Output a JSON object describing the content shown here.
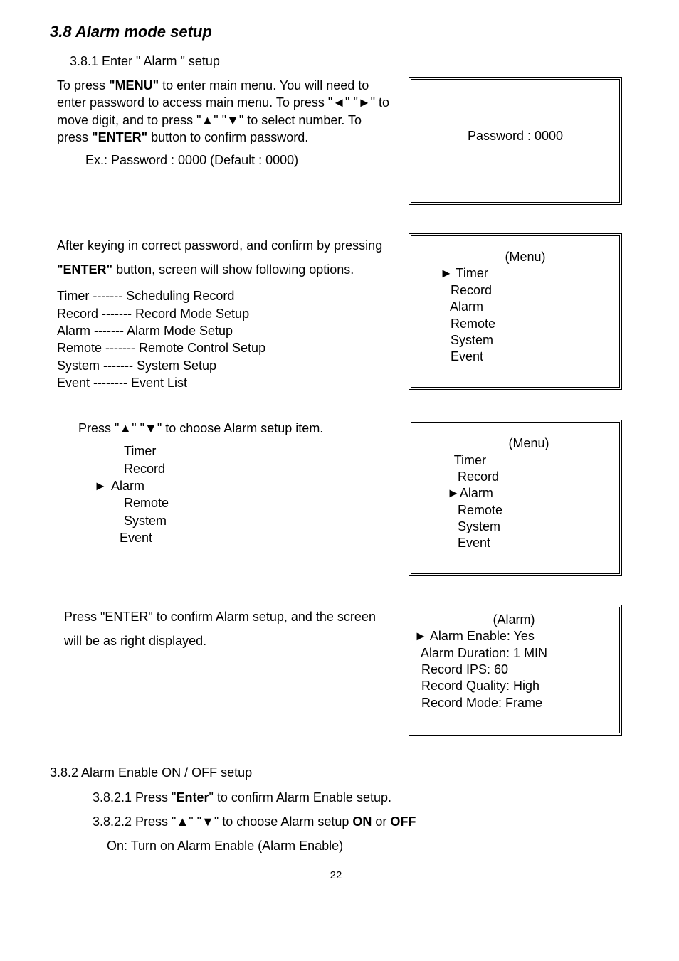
{
  "heading": "3.8   Alarm mode setup",
  "s381": "3.8.1   Enter \" Alarm \" setup",
  "p1a": "To press ",
  "p1b": "\"MENU\"",
  "p1c": " to enter main menu. You will need to enter password to access main menu. To press \"◄\" \"►\"   to move digit, and to press   \"▲\" \"▼\" to select number. To press ",
  "p1d": "\"ENTER\"",
  "p1e": " button to confirm password.",
  "p2": "Ex.: Password : 0000   (Default : 0000)",
  "box1": {
    "line1": "Password : 0000"
  },
  "p3a": "After keying in correct password, and confirm by pressing ",
  "p3b": "\"ENTER\"",
  "p3c": " button, screen will show following options.",
  "list1": [
    "Timer   ------- Scheduling Record",
    "Record ------- Record Mode Setup",
    "Alarm   ------- Alarm Mode Setup",
    "Remote ------- Remote Control Setup",
    "System ------- System Setup",
    "Event   -------- Event List"
  ],
  "box2": {
    "title": "(Menu)",
    "items": [
      {
        "marker": "►",
        "label": "Timer"
      },
      {
        "marker": "",
        "label": "Record"
      },
      {
        "marker": "",
        "label": "Alarm"
      },
      {
        "marker": "",
        "label": "Remote"
      },
      {
        "marker": "",
        "label": "System"
      },
      {
        "marker": "",
        "label": "Event"
      }
    ]
  },
  "p4": "Press \"▲\" \"▼\" to choose Alarm setup item.",
  "sublist": [
    {
      "marker": "",
      "label": "Timer"
    },
    {
      "marker": "",
      "label": "Record"
    },
    {
      "marker": "►",
      "label": "Alarm"
    },
    {
      "marker": "",
      "label": "Remote"
    },
    {
      "marker": "",
      "label": " System"
    },
    {
      "marker": "",
      "label": "Event"
    }
  ],
  "box3": {
    "title": "(Menu)",
    "items": [
      {
        "marker": "",
        "label": "Timer"
      },
      {
        "marker": "",
        "label": " Record"
      },
      {
        "marker": "►",
        "label": "Alarm"
      },
      {
        "marker": "",
        "label": " Remote"
      },
      {
        "marker": "",
        "label": " System"
      },
      {
        "marker": "",
        "label": " Event"
      }
    ]
  },
  "p5": "Press \"ENTER\" to confirm Alarm setup, and the screen will be as right displayed.",
  "box4": {
    "title": "(Alarm)",
    "lines": [
      "► Alarm Enable: Yes",
      "  Alarm Duration: 1 MIN",
      "  Record IPS: 60",
      "  Record Quality: High",
      "  Record Mode: Frame"
    ]
  },
  "s382": "3.8.2   Alarm Enable ON / OFF setup",
  "s3821a": "3.8.2.1 Press \"",
  "s3821b": "Enter",
  "s3821c": "\" to confirm Alarm Enable setup.",
  "s3822a": "3.8.2.2 Press \"▲\" \"▼\" to choose Alarm setup ",
  "s3822on": "ON",
  "s3822mid": " or ",
  "s3822off": "OFF",
  "s3822on_line": "On: Turn on Alarm Enable (Alarm Enable)",
  "pagenum": "22"
}
